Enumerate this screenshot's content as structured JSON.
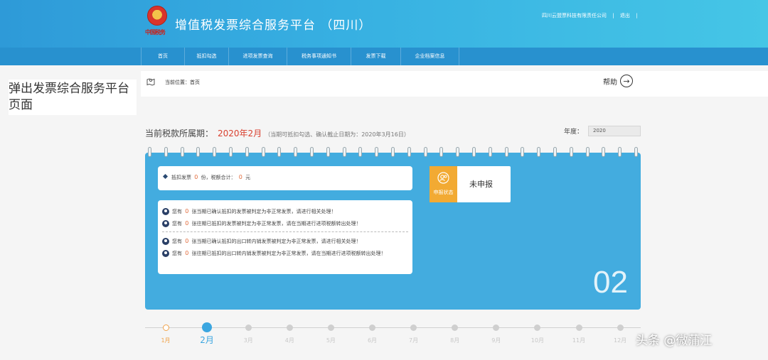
{
  "header": {
    "emblem_text": "中国税务",
    "title": "增值税发票综合服务平台 （四川）",
    "company": "四川云盟票科技有限责任公司",
    "logout": "退出",
    "separator": "|"
  },
  "nav": {
    "items": [
      {
        "label": "首页"
      },
      {
        "label": "抵扣勾选"
      },
      {
        "label": "进项发票查询"
      },
      {
        "label": "税务事项通知书"
      },
      {
        "label": "发票下载"
      },
      {
        "label": "企业档案信息"
      }
    ]
  },
  "breadcrumb": {
    "label": "当前位置：首页"
  },
  "help": {
    "label": "帮助",
    "icon": "arrow-right-circle-icon"
  },
  "overlay_title": "弹出发票综合服务平台页面",
  "period": {
    "label": "当前税款所属期：",
    "value": "2020年2月",
    "note": "（当期可抵扣勾选、确认截止日期为：2020年3月16日）"
  },
  "year": {
    "label": "年度：",
    "value": "2020"
  },
  "summary": {
    "prefix": "抵扣发票",
    "count": "0",
    "mid": "份，税额合计：",
    "amount": "0",
    "suffix": "元"
  },
  "notices": [
    {
      "pre": "您有",
      "count": "0",
      "text": "张当期已确认抵扣的发票被判定为非正常发票，请进行相关处理！"
    },
    {
      "pre": "您有",
      "count": "0",
      "text": "张往期已抵扣的发票被判定为非正常发票，请在当期进行进项税额转出处理！"
    },
    {
      "pre": "您有",
      "count": "0",
      "text": "张当期已确认抵扣的出口转内销发票被判定为非正常发票，请进行相关处理！"
    },
    {
      "pre": "您有",
      "count": "0",
      "text": "张往期已抵扣的出口转内销发票被判定为非正常发票，请在当期进行进项税额转出处理！"
    }
  ],
  "status": {
    "caption": "申报状态",
    "value": "未申报",
    "icon": "user-status-icon"
  },
  "big_month": "02",
  "months": [
    "1月",
    "2月",
    "3月",
    "4月",
    "5月",
    "6月",
    "7月",
    "8月",
    "9月",
    "10月",
    "11月",
    "12月"
  ],
  "active_month_index": 1,
  "watermark": "头条 @微蒲江",
  "colors": {
    "header_start": "#2e9ad8",
    "header_end": "#45c6e6",
    "nav": "#2891cf",
    "panel": "#43acdf",
    "accent_red": "#d9402f",
    "status_orange": "#f2aa33",
    "active_month": "#3ba6e0",
    "first_month": "#f0a24a"
  }
}
